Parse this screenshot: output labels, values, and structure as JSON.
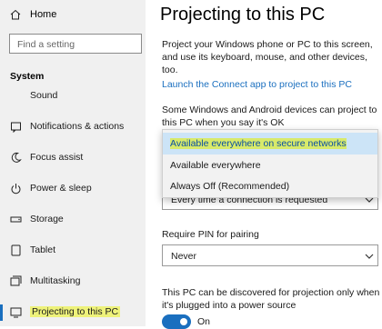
{
  "sidebar": {
    "home_label": "Home",
    "search_placeholder": "Find a setting",
    "section_title": "System",
    "items": [
      {
        "label": "Sound",
        "icon": "speaker-icon"
      },
      {
        "label": "Notifications & actions",
        "icon": "notification-icon"
      },
      {
        "label": "Focus assist",
        "icon": "moon-icon"
      },
      {
        "label": "Power & sleep",
        "icon": "power-icon"
      },
      {
        "label": "Storage",
        "icon": "storage-icon"
      },
      {
        "label": "Tablet",
        "icon": "tablet-icon"
      },
      {
        "label": "Multitasking",
        "icon": "multitasking-icon"
      },
      {
        "label": "Projecting to this PC",
        "icon": "projecting-icon"
      }
    ]
  },
  "main": {
    "title": "Projecting to this PC",
    "intro": "Project your Windows phone or PC to this screen, and use its keyboard, mouse, and other devices, too.",
    "connect_link": "Launch the Connect app to project to this PC",
    "windows_text": "Some Windows and Android devices can project to this PC when you say it's OK",
    "dropdown1": {
      "options": [
        "Available everywhere on secure networks",
        "Available everywhere",
        "Always Off (Recommended)"
      ],
      "selected_index": 0
    },
    "dropdown2_value": "Every time a connection is requested",
    "pin_label": "Require PIN for pairing",
    "pin_value": "Never",
    "discover_text": "This PC can be discovered for projection only when it's plugged into a power source",
    "toggle_label": "On"
  },
  "colors": {
    "accent": "#1a6fbf",
    "sidebar_bg": "#f0f0f0",
    "highlight": "#eef27a"
  }
}
